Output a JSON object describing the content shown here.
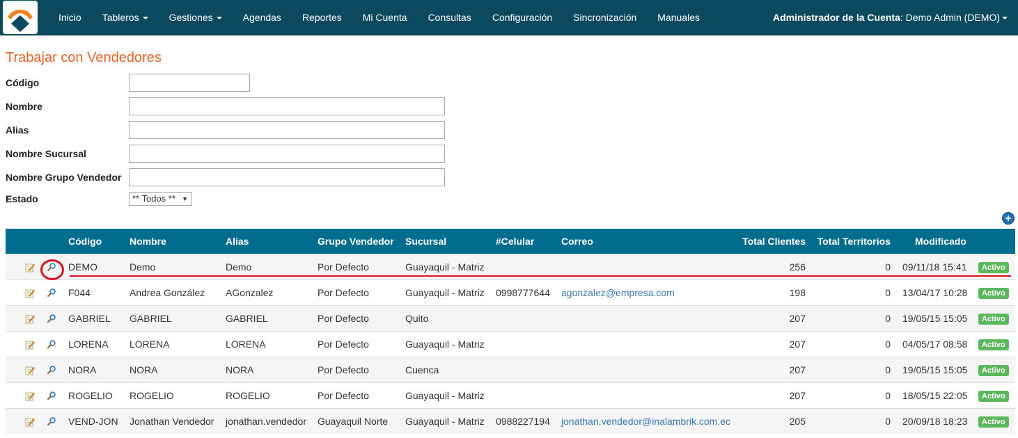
{
  "navbar": {
    "items": [
      {
        "label": "Inicio",
        "dropdown": false
      },
      {
        "label": "Tableros",
        "dropdown": true
      },
      {
        "label": "Gestiones",
        "dropdown": true
      },
      {
        "label": "Agendas",
        "dropdown": false
      },
      {
        "label": "Reportes",
        "dropdown": false
      },
      {
        "label": "Mi Cuenta",
        "dropdown": false
      },
      {
        "label": "Consultas",
        "dropdown": false
      },
      {
        "label": "Configuración",
        "dropdown": false
      },
      {
        "label": "Sincronización",
        "dropdown": false
      },
      {
        "label": "Manuales",
        "dropdown": false
      }
    ],
    "account_role": "Administrador de la Cuenta",
    "account_name": ": Demo Admin (DEMO)",
    "colors": {
      "background": "#0b4a5e",
      "logo_orange": "#f58220",
      "logo_blue": "#0b4a5e"
    }
  },
  "page": {
    "title": "Trabajar con Vendedores",
    "title_color": "#e6642a"
  },
  "filters": {
    "codigo": {
      "label": "Código",
      "value": "",
      "placeholder": ""
    },
    "nombre": {
      "label": "Nombre",
      "value": "",
      "placeholder": ""
    },
    "alias": {
      "label": "Alias",
      "value": "",
      "placeholder": ""
    },
    "sucursal": {
      "label": "Nombre Sucursal",
      "value": "",
      "placeholder": ""
    },
    "grupo": {
      "label": "Nombre Grupo Vendedor",
      "value": "",
      "placeholder": ""
    },
    "estado": {
      "label": "Estado",
      "selected": "** Todos **"
    }
  },
  "table": {
    "header_color": "#006c8e",
    "columns": [
      "Código",
      "Nombre",
      "Alias",
      "Grupo Vendedor",
      "Sucursal",
      "#Celular",
      "Correo",
      "Total Clientes",
      "Total Territorios",
      "Modificado"
    ],
    "rows": [
      {
        "codigo": "DEMO",
        "nombre": "Demo",
        "alias": "Demo",
        "grupo": "Por Defecto",
        "sucursal": "Guayaquil - Matriz",
        "celular": "",
        "correo": "",
        "clientes": "256",
        "territorios": "0",
        "modificado": "09/11/18 15:41",
        "estado": "Activo"
      },
      {
        "codigo": "F044",
        "nombre": "Andrea González",
        "alias": "AGonzalez",
        "grupo": "Por Defecto",
        "sucursal": "Guayaquil - Matriz",
        "celular": "0998777644",
        "correo": "agonzalez@empresa.com",
        "clientes": "198",
        "territorios": "0",
        "modificado": "13/04/17 10:28",
        "estado": "Activo"
      },
      {
        "codigo": "GABRIEL",
        "nombre": "GABRIEL",
        "alias": "GABRIEL",
        "grupo": "Por Defecto",
        "sucursal": "Quito",
        "celular": "",
        "correo": "",
        "clientes": "207",
        "territorios": "0",
        "modificado": "19/05/15 15:05",
        "estado": "Activo"
      },
      {
        "codigo": "LORENA",
        "nombre": "LORENA",
        "alias": "LORENA",
        "grupo": "Por Defecto",
        "sucursal": "Guayaquil - Matriz",
        "celular": "",
        "correo": "",
        "clientes": "207",
        "territorios": "0",
        "modificado": "04/05/17 08:58",
        "estado": "Activo"
      },
      {
        "codigo": "NORA",
        "nombre": "NORA",
        "alias": "NORA",
        "grupo": "Por Defecto",
        "sucursal": "Cuenca",
        "celular": "",
        "correo": "",
        "clientes": "207",
        "territorios": "0",
        "modificado": "19/05/15 15:05",
        "estado": "Activo"
      },
      {
        "codigo": "ROGELIO",
        "nombre": "ROGELIO",
        "alias": "ROGELIO",
        "grupo": "Por Defecto",
        "sucursal": "Guayaquil - Matriz",
        "celular": "",
        "correo": "",
        "clientes": "207",
        "territorios": "0",
        "modificado": "18/05/15 22:05",
        "estado": "Activo"
      },
      {
        "codigo": "VEND-JON",
        "nombre": "Jonathan Vendedor",
        "alias": "jonathan.vendedor",
        "grupo": "Guayaquil Norte",
        "sucursal": "Guayaquil - Matriz",
        "celular": "0988227194",
        "correo": "jonathan.vendedor@inalambrik.com.ec",
        "clientes": "205",
        "territorios": "0",
        "modificado": "20/09/18 18:23",
        "estado": "Activo"
      }
    ],
    "badge_color": "#5cb85c",
    "link_color": "#3a7ab8"
  },
  "annotation": {
    "color": "#e0111e"
  }
}
